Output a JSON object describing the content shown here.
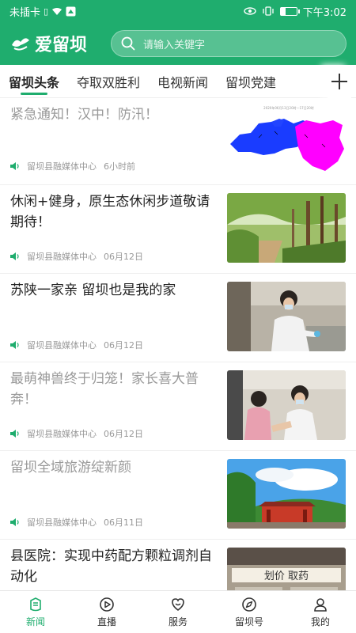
{
  "status_bar": {
    "carrier": "未插卡",
    "time": "下午3:02",
    "battery_level": 0.3
  },
  "header": {
    "app_name": "爱留坝",
    "search_placeholder": "请输入关键字"
  },
  "tabs": [
    "留坝头条",
    "夺取双胜利",
    "电视新闻",
    "留坝党建"
  ],
  "news": [
    {
      "title": "紧急通知！汉中！防汛！",
      "source": "留坝县融媒体中心",
      "time": "6小时前",
      "read": true,
      "thumb": "map"
    },
    {
      "title": "休闲+健身，原生态休闲步道敬请期待！",
      "source": "留坝县融媒体中心",
      "time": "06月12日",
      "read": false,
      "thumb": "forest"
    },
    {
      "title": "苏陕一家亲 留坝也是我的家",
      "source": "留坝县融媒体中心",
      "time": "06月12日",
      "read": false,
      "thumb": "lab"
    },
    {
      "title": "最萌神兽终于归笼！家长喜大普奔！",
      "source": "留坝县融媒体中心",
      "time": "06月12日",
      "read": true,
      "thumb": "clinic"
    },
    {
      "title": "留坝全域旅游绽新颜",
      "source": "留坝县融媒体中心",
      "time": "06月11日",
      "read": true,
      "thumb": "temple"
    },
    {
      "title": "县医院：实现中药配方颗粒调剂自动化",
      "source": "",
      "time": "",
      "read": false,
      "thumb": "pharmacy"
    }
  ],
  "thumb_text": {
    "map_caption": "2020年06月13日20时—17日20时",
    "pharmacy_sign": "划价 取药"
  },
  "nav": [
    {
      "label": "新闻",
      "icon": "news-icon",
      "active": true
    },
    {
      "label": "直播",
      "icon": "play-icon",
      "active": false
    },
    {
      "label": "服务",
      "icon": "service-icon",
      "active": false
    },
    {
      "label": "留坝号",
      "icon": "compass-icon",
      "active": false
    },
    {
      "label": "我的",
      "icon": "user-icon",
      "active": false
    }
  ],
  "colors": {
    "brand": "#1fad6e",
    "read_text": "#999999",
    "text": "#222222"
  }
}
